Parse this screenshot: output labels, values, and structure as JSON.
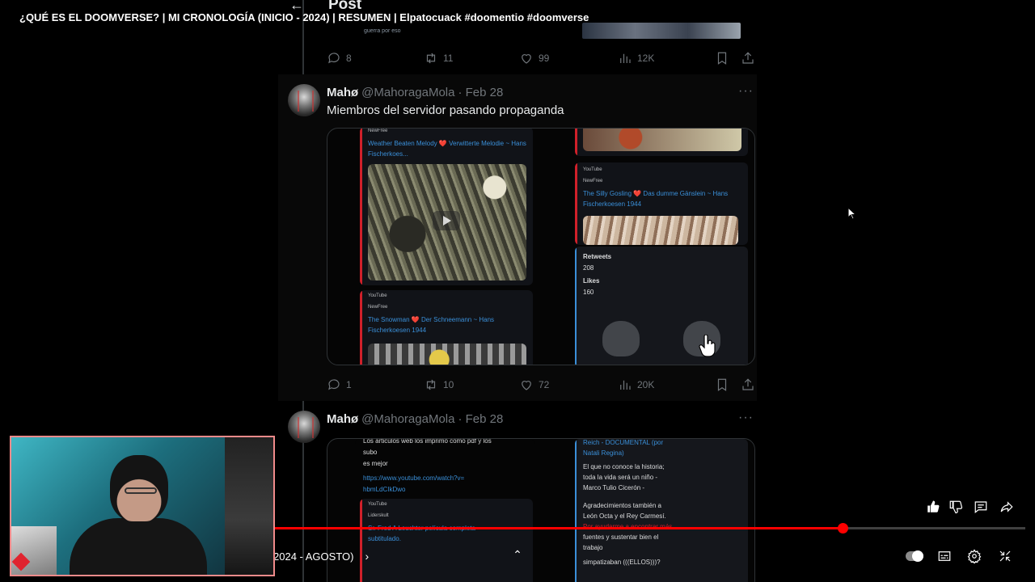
{
  "video": {
    "title": "¿QUÉ ES EL DOOMVERSE? | MI CRONOLOGÍA (INICIO - 2024) | RESUMEN | Elpatocuack #doomentio #doomverse"
  },
  "xpage": {
    "header_title": "Post",
    "snippet": "guerra por eso",
    "top_actions": {
      "replies": "8",
      "reposts": "11",
      "likes": "99",
      "views": "12K"
    },
    "tweets": [
      {
        "name": "Mahø",
        "handle": "@MahoragaMola",
        "date": "· Feb 28",
        "text": "Miembros del servidor pasando propaganda",
        "actions": {
          "replies": "1",
          "reposts": "10",
          "likes": "72",
          "views": "20K"
        },
        "media": {
          "p1_src": "NewFree",
          "p1_title": "Weather Beaten Melody ❤️ Verwitterte Melodie ~ Hans Fischerkoes...",
          "p2_src1": "YouTube",
          "p2_src2": "NewFree",
          "p2_title": "The Snowman ❤️ Der Schneemann ~ Hans Fischerkoesen 1944",
          "p3_src1": "YouTube",
          "p3_src2": "NewFree",
          "p3_title": "The Silly Gosling ❤️ Das dumme Gänslein ~ Hans Fischerkoesen 1944",
          "p4_retweets_label": "Retweets",
          "p4_retweets": "208",
          "p4_likes_label": "Likes",
          "p4_likes": "160"
        }
      },
      {
        "name": "Mahø",
        "handle": "@MahoragaMola",
        "date": "· Feb 28",
        "media": {
          "l1": "Los articulos web los imprimo como pdf y los",
          "l2": "subo",
          "l3": "es mejor",
          "link1": "https://www.youtube.com/watch?v=",
          "link2": "hbmLdCIkDwo",
          "src1": "YouTube",
          "src2": "Liderskult",
          "ptitle1": "Sr. Fred A Leuchter película completa",
          "ptitle2": "subtitulado.",
          "r_title1": "Reich - DOCUMENTAL (por",
          "r_title2": "Natali Regina)",
          "r1": "El que no conoce la historia;",
          "r2": "toda la vida será un niño -",
          "r3": "Marco Tulio Cicerón -",
          "r4": "Agradecimientos también a",
          "r5": "León Octa y el Rey Carmesí.",
          "r6": "Por ayudarme a encontrar más",
          "r7": "fuentes y sustentar bien el",
          "r8": "trabajo",
          "r9": "simpatizaban (((ELLOS)))?"
        }
      }
    ]
  },
  "player": {
    "chapter_label": "2024 - AGOSTO)",
    "progress_fraction": 0.757,
    "accent": "#ff0000",
    "icons": [
      "like-icon",
      "dislike-icon",
      "comment-icon",
      "share-icon",
      "autoplay-toggle",
      "subtitles-icon",
      "settings-icon",
      "exit-fullscreen-icon"
    ]
  }
}
